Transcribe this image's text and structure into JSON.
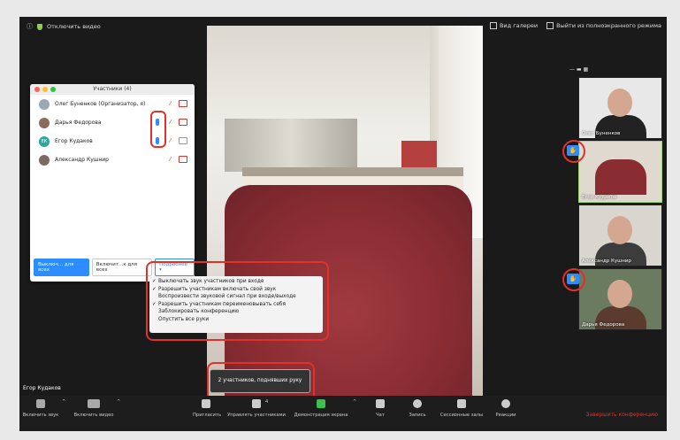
{
  "topbar": {
    "recording_label": "Отключить видео",
    "gallery_label": "Вид галереи",
    "exit_fullscreen_label": "Выйти из полноэкранного режима"
  },
  "participants_panel": {
    "title": "Участники (4)",
    "participants": [
      {
        "name": "Олег Буненков (Организатор, я)"
      },
      {
        "name": "Дарья Федорова"
      },
      {
        "name": "Егор Кудаков"
      },
      {
        "name": "Александр Кушнир"
      }
    ],
    "mute_all_label": "Выключ... для всех",
    "unmute_all_label": "Включит...к для всех",
    "more_label": "Подробнее ▾"
  },
  "more_menu": {
    "items": [
      {
        "label": "Выключать звук участников при входе",
        "checked": true
      },
      {
        "label": "Разрешить участникам включать свой звук",
        "checked": true
      },
      {
        "label": "Воспроизвести звуковой сигнал при входе/выходе",
        "checked": false
      },
      {
        "label": "Разрешить участникам переименовывать себя",
        "checked": true
      },
      {
        "label": "Заблокировать конференцию",
        "checked": false
      },
      {
        "label": "Опустить все руки",
        "checked": false
      }
    ]
  },
  "thumbnails": [
    {
      "name": "Олег Буненков"
    },
    {
      "name": "Егор Кудаков"
    },
    {
      "name": "Александр Кушнир"
    },
    {
      "name": "Дарья Федорова"
    }
  ],
  "tooltip": "2 участников, поднявших руку",
  "self_name": "Егор Кудаков",
  "toolbar": {
    "audio_label": "Включить звук",
    "video_label": "Включить видео",
    "invite_label": "Пригласить",
    "manage_label": "Управлять участниками",
    "manage_count": "4",
    "share_label": "Демонстрация экрана",
    "chat_label": "Чат",
    "record_label": "Запись",
    "breakout_label": "Сессионные залы",
    "reactions_label": "Реакции",
    "end_label": "Завершить конференцию"
  },
  "colors": {
    "accent": "#2d8cff",
    "highlight_ring": "#e0312b",
    "end_red": "#e0312b"
  }
}
